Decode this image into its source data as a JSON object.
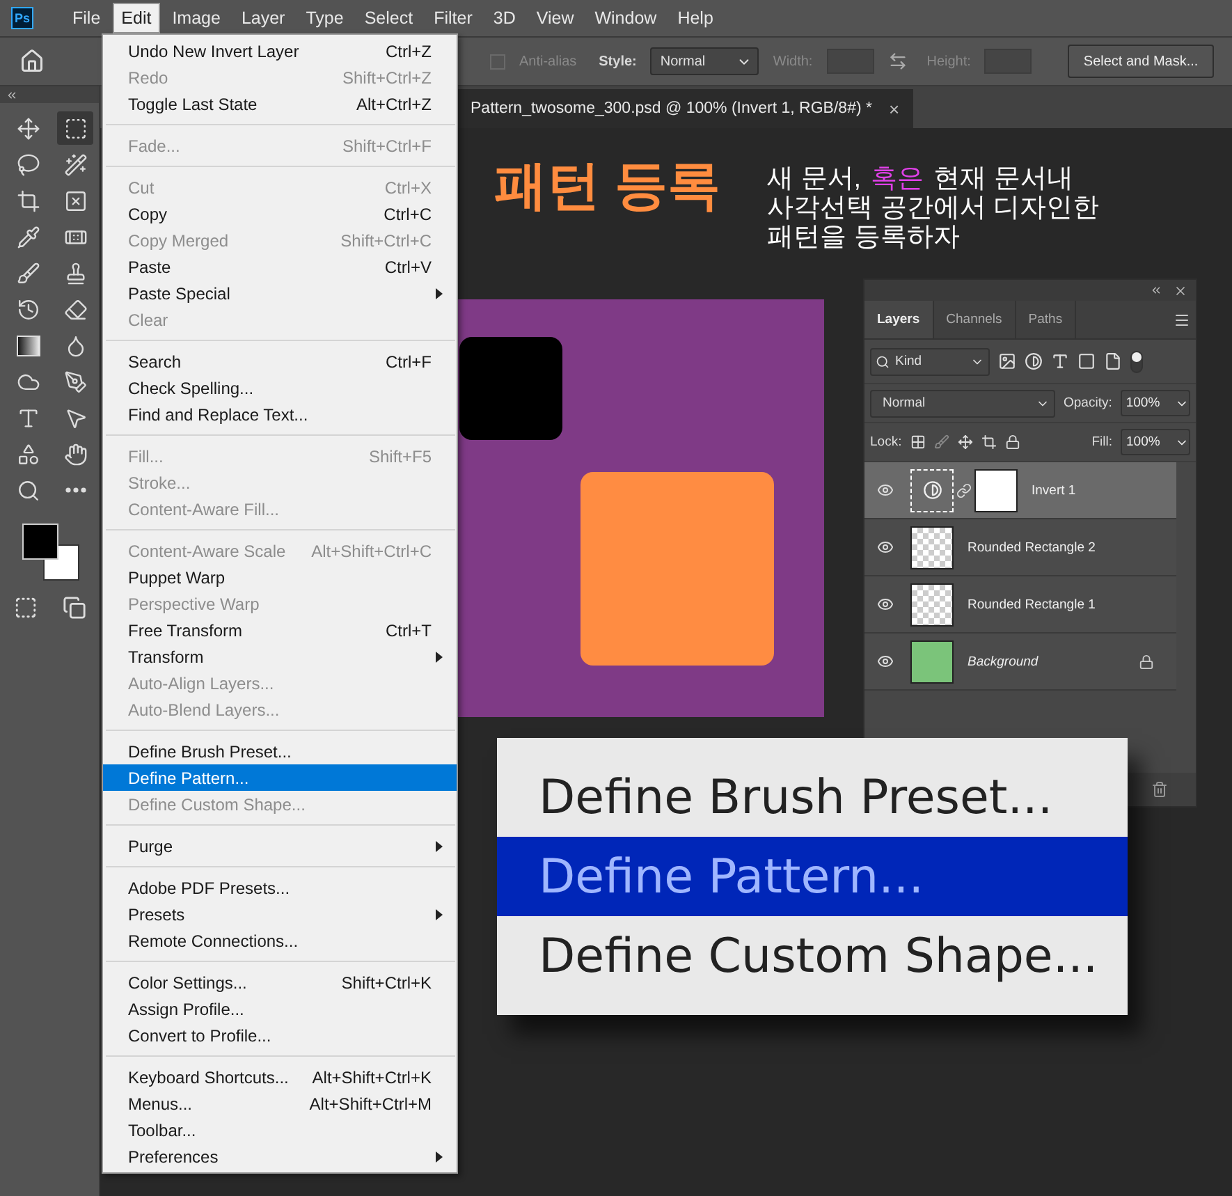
{
  "app_icon": "Ps",
  "menu_bar": [
    {
      "label": "File",
      "selected": false
    },
    {
      "label": "Edit",
      "selected": true
    },
    {
      "label": "Image",
      "selected": false
    },
    {
      "label": "Layer",
      "selected": false
    },
    {
      "label": "Type",
      "selected": false
    },
    {
      "label": "Select",
      "selected": false
    },
    {
      "label": "Filter",
      "selected": false
    },
    {
      "label": "3D",
      "selected": false
    },
    {
      "label": "View",
      "selected": false
    },
    {
      "label": "Window",
      "selected": false
    },
    {
      "label": "Help",
      "selected": false
    }
  ],
  "options_bar": {
    "anti_alias": {
      "label": "Anti-alias",
      "checked": false,
      "disabled": true
    },
    "style_label": "Style:",
    "style_value": "Normal",
    "width_label": "Width:",
    "height_label": "Height:",
    "select_and_mask": "Select and Mask..."
  },
  "document_tab": {
    "title": "Pattern_twosome_300.psd @ 100% (Invert 1, RGB/8#) *",
    "close": "×"
  },
  "tools": [
    {
      "kind": "move",
      "selected": false
    },
    {
      "kind": "marquee",
      "selected": true
    },
    {
      "kind": "lasso",
      "selected": false
    },
    {
      "kind": "wand",
      "selected": false
    },
    {
      "kind": "crop",
      "selected": false
    },
    {
      "kind": "frame",
      "selected": false
    },
    {
      "kind": "eyedropper",
      "selected": false
    },
    {
      "kind": "healing",
      "selected": false
    },
    {
      "kind": "brush",
      "selected": false
    },
    {
      "kind": "stamp",
      "selected": false
    },
    {
      "kind": "history",
      "selected": false
    },
    {
      "kind": "eraser",
      "selected": false
    },
    {
      "kind": "gradient",
      "selected": false
    },
    {
      "kind": "blur",
      "selected": false
    },
    {
      "kind": "dodge",
      "selected": false
    },
    {
      "kind": "pen",
      "selected": false
    },
    {
      "kind": "type",
      "selected": false
    },
    {
      "kind": "path",
      "selected": false
    },
    {
      "kind": "shape",
      "selected": false
    },
    {
      "kind": "hand",
      "selected": false
    },
    {
      "kind": "zoom",
      "selected": false
    },
    {
      "kind": "more",
      "selected": false
    }
  ],
  "edit_menu": [
    [
      {
        "label": "Undo New Invert Layer",
        "shortcut": "Ctrl+Z",
        "disabled": false,
        "selected": false
      },
      {
        "label": "Redo",
        "shortcut": "Shift+Ctrl+Z",
        "disabled": true,
        "selected": false
      },
      {
        "label": "Toggle Last State",
        "shortcut": "Alt+Ctrl+Z",
        "disabled": false,
        "selected": false
      }
    ],
    [
      {
        "label": "Fade...",
        "shortcut": "Shift+Ctrl+F",
        "disabled": true,
        "selected": false
      }
    ],
    [
      {
        "label": "Cut",
        "shortcut": "Ctrl+X",
        "disabled": true,
        "selected": false
      },
      {
        "label": "Copy",
        "shortcut": "Ctrl+C",
        "disabled": false,
        "selected": false
      },
      {
        "label": "Copy Merged",
        "shortcut": "Shift+Ctrl+C",
        "disabled": true,
        "selected": false
      },
      {
        "label": "Paste",
        "shortcut": "Ctrl+V",
        "disabled": false,
        "selected": false
      },
      {
        "label": "Paste Special",
        "submenu": true,
        "disabled": false,
        "selected": false
      },
      {
        "label": "Clear",
        "disabled": true,
        "selected": false
      }
    ],
    [
      {
        "label": "Search",
        "shortcut": "Ctrl+F",
        "disabled": false,
        "selected": false
      },
      {
        "label": "Check Spelling...",
        "disabled": false,
        "selected": false
      },
      {
        "label": "Find and Replace Text...",
        "disabled": false,
        "selected": false
      }
    ],
    [
      {
        "label": "Fill...",
        "shortcut": "Shift+F5",
        "disabled": true,
        "selected": false
      },
      {
        "label": "Stroke...",
        "disabled": true,
        "selected": false
      },
      {
        "label": "Content-Aware Fill...",
        "disabled": true,
        "selected": false
      }
    ],
    [
      {
        "label": "Content-Aware Scale",
        "shortcut": "Alt+Shift+Ctrl+C",
        "disabled": true,
        "selected": false
      },
      {
        "label": "Puppet Warp",
        "disabled": false,
        "selected": false
      },
      {
        "label": "Perspective Warp",
        "disabled": true,
        "selected": false
      },
      {
        "label": "Free Transform",
        "shortcut": "Ctrl+T",
        "disabled": false,
        "selected": false
      },
      {
        "label": "Transform",
        "submenu": true,
        "disabled": false,
        "selected": false
      },
      {
        "label": "Auto-Align Layers...",
        "disabled": true,
        "selected": false
      },
      {
        "label": "Auto-Blend Layers...",
        "disabled": true,
        "selected": false
      }
    ],
    [
      {
        "label": "Define Brush Preset...",
        "disabled": false,
        "selected": false
      },
      {
        "label": "Define Pattern...",
        "disabled": false,
        "selected": true
      },
      {
        "label": "Define Custom Shape...",
        "disabled": true,
        "selected": false
      }
    ],
    [
      {
        "label": "Purge",
        "submenu": true,
        "disabled": false,
        "selected": false
      }
    ],
    [
      {
        "label": "Adobe PDF Presets...",
        "disabled": false,
        "selected": false
      },
      {
        "label": "Presets",
        "submenu": true,
        "disabled": false,
        "selected": false
      },
      {
        "label": "Remote Connections...",
        "disabled": false,
        "selected": false
      }
    ],
    [
      {
        "label": "Color Settings...",
        "shortcut": "Shift+Ctrl+K",
        "disabled": false,
        "selected": false
      },
      {
        "label": "Assign Profile...",
        "disabled": false,
        "selected": false
      },
      {
        "label": "Convert to Profile...",
        "disabled": false,
        "selected": false
      }
    ],
    [
      {
        "label": "Keyboard Shortcuts...",
        "shortcut": "Alt+Shift+Ctrl+K",
        "disabled": false,
        "selected": false
      },
      {
        "label": "Menus...",
        "shortcut": "Alt+Shift+Ctrl+M",
        "disabled": false,
        "selected": false
      },
      {
        "label": "Toolbar...",
        "disabled": false,
        "selected": false
      },
      {
        "label": "Preferences",
        "submenu": true,
        "disabled": false,
        "selected": false
      }
    ]
  ],
  "annotation": {
    "title": "패턴 등록",
    "lines": [
      [
        {
          "text": "새 문서,",
          "color": "#ffffff"
        },
        {
          "text": "혹은",
          "color": "#e040e8"
        },
        {
          "text": "현재 문서내",
          "color": "#ffffff"
        }
      ],
      [
        {
          "text": "사각선택 공간에서 디자인한",
          "color": "#ffffff"
        }
      ],
      [
        {
          "text": "패턴을 등록하자",
          "color": "#ffffff"
        }
      ]
    ]
  },
  "layers_panel": {
    "tabs": [
      {
        "label": "Layers",
        "selected": true
      },
      {
        "label": "Channels",
        "selected": false
      },
      {
        "label": "Paths",
        "selected": false
      }
    ],
    "filter": "Kind",
    "blend_mode": "Normal",
    "opacity_label": "Opacity:",
    "opacity": "100%",
    "lock_label": "Lock:",
    "fill_label": "Fill:",
    "fill": "100%",
    "layers": [
      {
        "name": "Invert 1",
        "kind": "adjustment",
        "visible": true,
        "selected": true,
        "locked": false
      },
      {
        "name": "Rounded Rectangle 2",
        "kind": "shape",
        "visible": true,
        "selected": false,
        "locked": false
      },
      {
        "name": "Rounded Rectangle 1",
        "kind": "shape",
        "visible": true,
        "selected": false,
        "locked": false
      },
      {
        "name": "Background",
        "kind": "background",
        "visible": true,
        "selected": false,
        "locked": true
      }
    ]
  },
  "zoom_callout": [
    {
      "label": "Define Brush Preset...",
      "selected": false
    },
    {
      "label": "Define Pattern...",
      "selected": true
    },
    {
      "label": "Define Custom Shape...",
      "selected": false
    }
  ]
}
